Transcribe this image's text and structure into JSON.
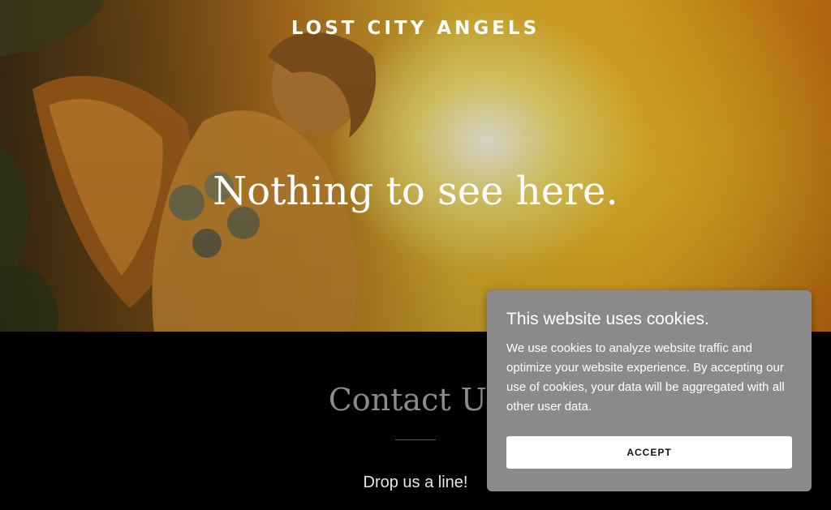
{
  "header": {
    "brand": "LOST CITY ANGELS"
  },
  "hero": {
    "title": "Nothing to see here."
  },
  "contact": {
    "title": "Contact Us",
    "subtitle": "Drop us a line!"
  },
  "cookie_banner": {
    "title": "This website uses cookies.",
    "body": "We use cookies to analyze website traffic and optimize your website experience. By accepting our use of cookies, your data will be aggregated with all other user data.",
    "accept_label": "ACCEPT"
  },
  "colors": {
    "page_background": "#000000",
    "banner_background": "#8a8a8a",
    "contact_title": "#8c8c8c",
    "button_background": "#ffffff"
  }
}
